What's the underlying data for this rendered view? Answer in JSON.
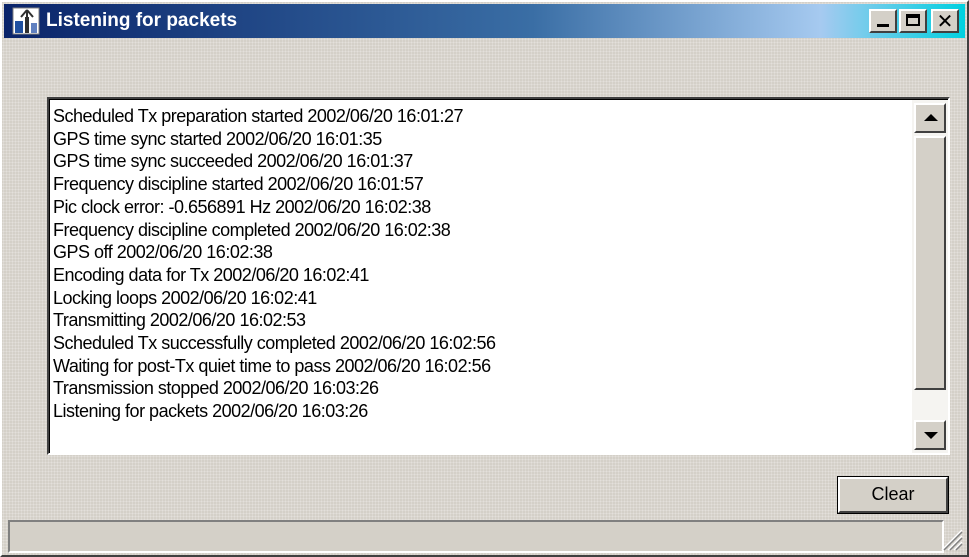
{
  "window": {
    "title": "Listening for packets",
    "controls": {
      "minimize": "_",
      "maximize": "□",
      "close": "✕"
    }
  },
  "log": {
    "lines": [
      "Scheduled Tx preparation started 2002/06/20 16:01:27",
      "GPS time sync started 2002/06/20 16:01:35",
      "GPS time sync succeeded 2002/06/20 16:01:37",
      "Frequency discipline started 2002/06/20 16:01:57",
      "Pic clock error: -0.656891 Hz 2002/06/20 16:02:38",
      "Frequency discipline completed 2002/06/20 16:02:38",
      "GPS off 2002/06/20 16:02:38",
      "Encoding data for Tx 2002/06/20 16:02:41",
      "Locking loops 2002/06/20 16:02:41",
      "Transmitting 2002/06/20 16:02:53",
      "Scheduled Tx successfully completed 2002/06/20 16:02:56",
      "Waiting for post-Tx quiet time to pass 2002/06/20 16:02:56",
      "Transmission stopped 2002/06/20 16:03:26",
      "Listening for packets 2002/06/20 16:03:26"
    ]
  },
  "buttons": {
    "clear": "Clear"
  },
  "status": {
    "text": ""
  },
  "colors": {
    "titlebar_start": "#0a246a",
    "titlebar_end": "#00d0e0",
    "face": "#d4d0c8"
  }
}
